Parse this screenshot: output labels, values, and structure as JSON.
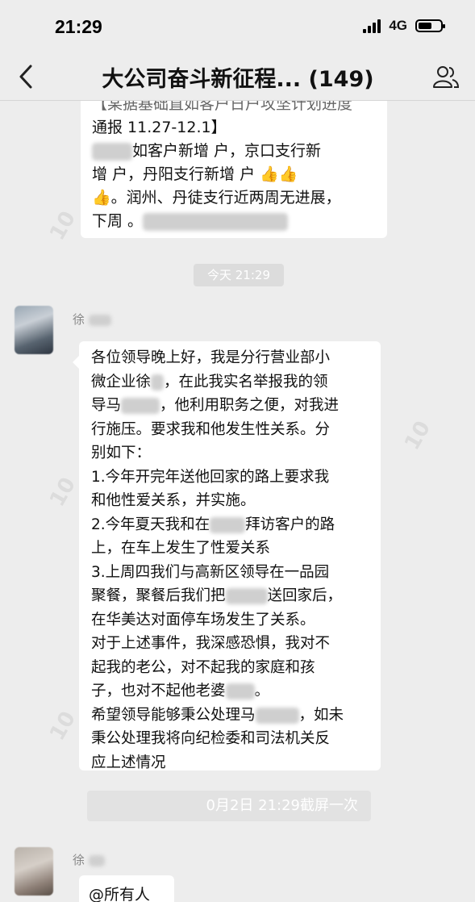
{
  "status_bar": {
    "time": "21:29",
    "network": "4G"
  },
  "nav": {
    "title": "大公司奋斗新征程... (149)"
  },
  "messages": {
    "top_bubble": {
      "lines": [
        "【某据基础直如客户日户攻坚计划进度",
        "通报 11.27-12.1】",
        "如客户新增 户，京口支行新",
        "增 户，丹阳支行新增 户 👍👍",
        "👍。润州、丹徒支行近两周无进展，",
        "下周 。"
      ]
    },
    "timestamp_1": "今天 21:29",
    "sender_1": "徐",
    "main_bubble": {
      "lines": [
        "各位领导晚上好，我是分行营业部小",
        "微企业徐",
        "，在此我实名举报我的领",
        "导马",
        "，他利用职务之便，对我进",
        "行施压。要求我和他发生性关系。分",
        "别如下：",
        "1.今年开完年送他回家的路上要求我",
        "和他性爱关系，并实施。",
        "2.今年夏天我和在",
        "拜访客户的路",
        "上，在车上发生了性爱关系",
        "3.上周四我们与高新区领导在一品园",
        "聚餐，聚餐后我们把",
        "送回家后，",
        "在华美达对面停车场发生了关系。",
        "对于上述事件，我深感恐惧，我对不",
        "起我的老公，对不起我的家庭和孩",
        "子，也对不起他老婆",
        "。",
        "希望领导能够秉公处理马",
        "，如未",
        "秉公处理我将向纪检委和司法机关反",
        "应上述情况"
      ]
    },
    "timestamp_2": "0月2日 21:29截屏一次",
    "sender_2": "徐",
    "last_bubble": "@所有人"
  }
}
